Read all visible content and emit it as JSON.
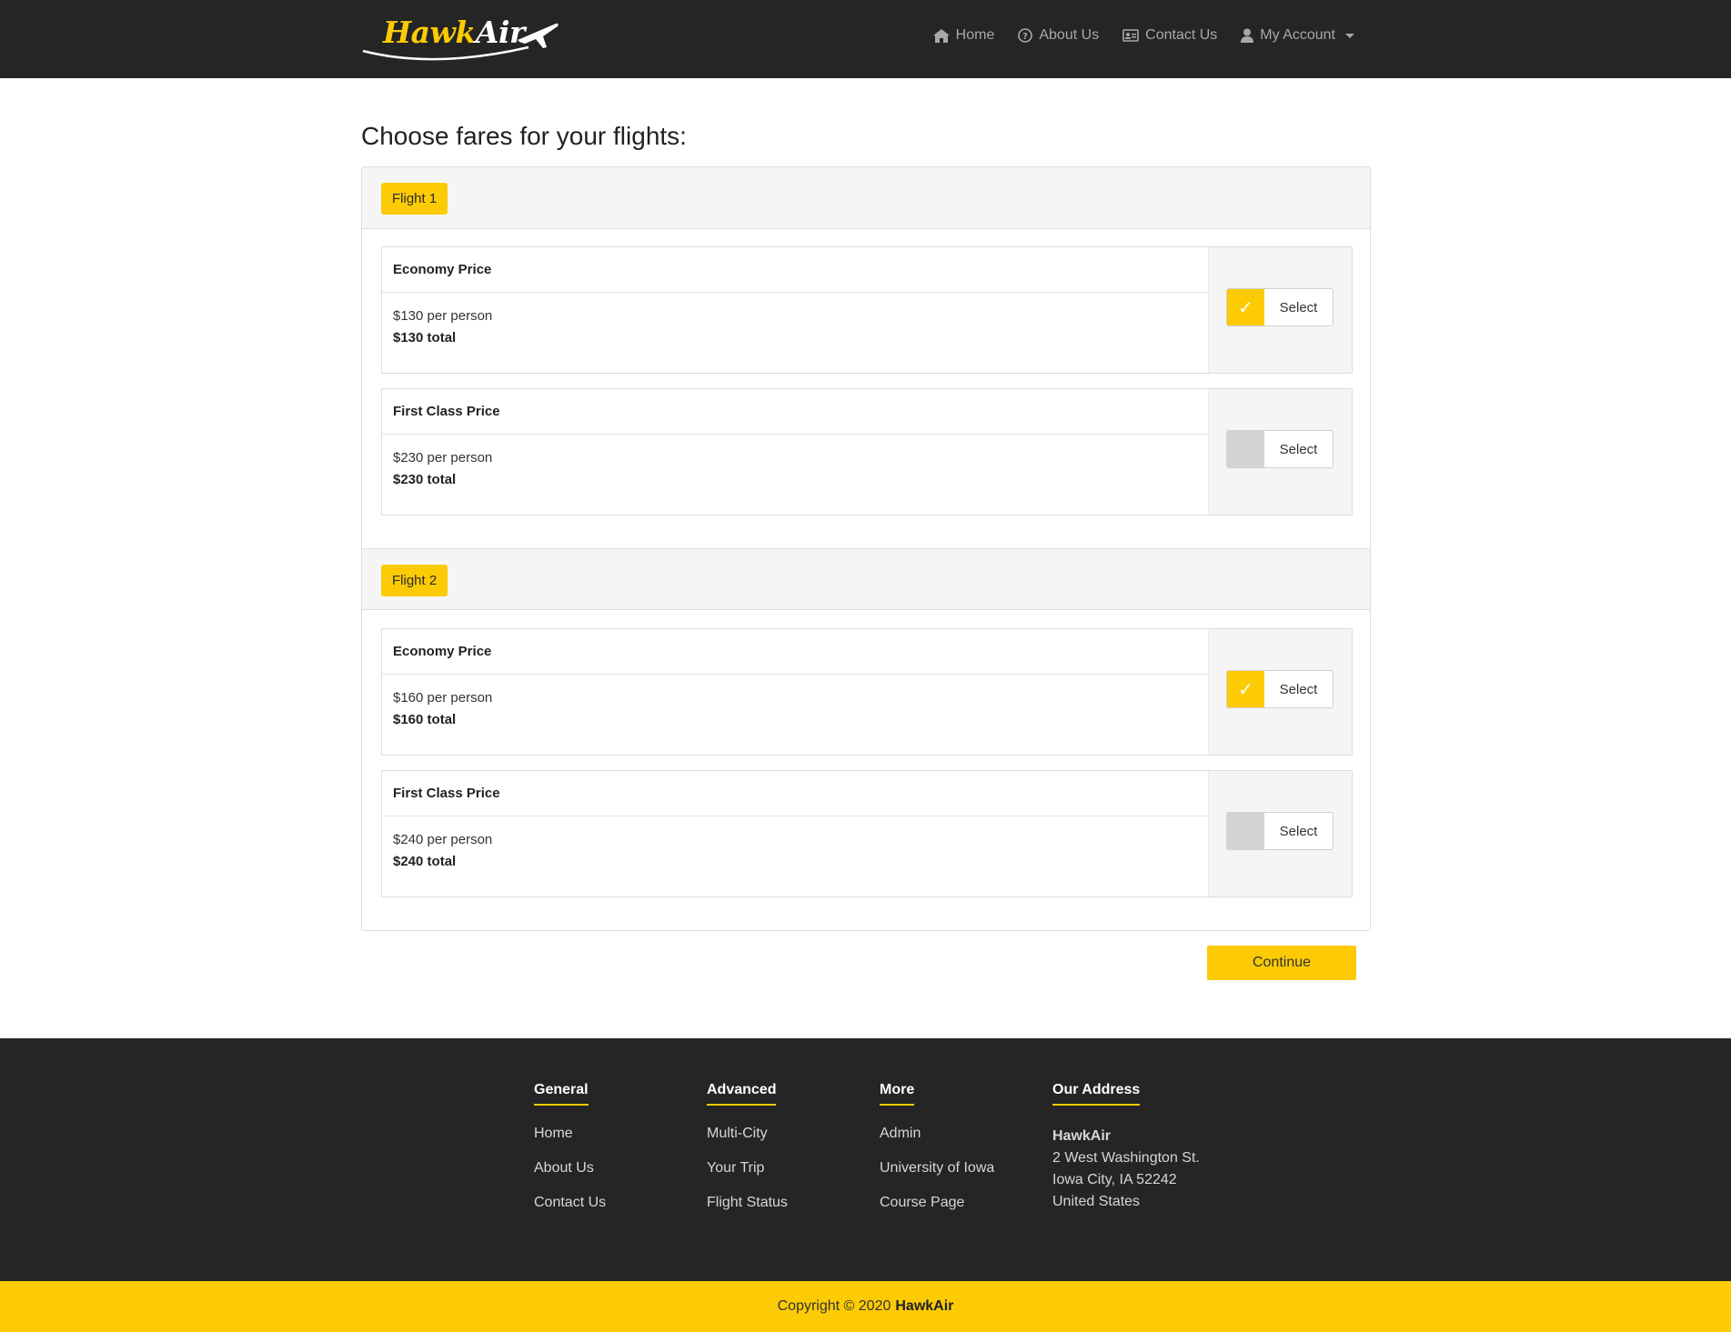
{
  "brand": {
    "hawk": "Hawk",
    "air": "Air",
    "icon": "airplane-icon"
  },
  "nav": {
    "home": {
      "label": "Home",
      "icon": "home-icon"
    },
    "about": {
      "label": "About Us",
      "icon": "question-circle-icon"
    },
    "contact": {
      "label": "Contact Us",
      "icon": "id-card-icon"
    },
    "account": {
      "label": "My Account",
      "icon": "user-icon"
    }
  },
  "page": {
    "title": "Choose fares for your flights:"
  },
  "flights": [
    {
      "badge": "Flight 1",
      "options": [
        {
          "title": "Economy Price",
          "per_person": "$130 per person",
          "total": "$130 total",
          "selected": true,
          "select_label": "Select",
          "check": "✓"
        },
        {
          "title": "First Class Price",
          "per_person": "$230 per person",
          "total": "$230 total",
          "selected": false,
          "select_label": "Select",
          "check": ""
        }
      ]
    },
    {
      "badge": "Flight 2",
      "options": [
        {
          "title": "Economy Price",
          "per_person": "$160 per person",
          "total": "$160 total",
          "selected": true,
          "select_label": "Select",
          "check": "✓"
        },
        {
          "title": "First Class Price",
          "per_person": "$240 per person",
          "total": "$240 total",
          "selected": false,
          "select_label": "Select",
          "check": ""
        }
      ]
    }
  ],
  "continue_label": "Continue",
  "footer": {
    "general": {
      "heading": "General",
      "links": [
        "Home",
        "About Us",
        "Contact Us"
      ]
    },
    "advanced": {
      "heading": "Advanced",
      "links": [
        "Multi-City",
        "Your Trip",
        "Flight Status"
      ]
    },
    "more": {
      "heading": "More",
      "links": [
        "Admin",
        "University of Iowa",
        "Course Page"
      ]
    },
    "address": {
      "heading": "Our Address",
      "name": "HawkAir",
      "lines": [
        "2 West Washington St.",
        "Iowa City, IA 52242",
        "United States"
      ]
    }
  },
  "copyright": {
    "text": "Copyright © 2020",
    "brand": "HawkAir"
  },
  "colors": {
    "accent": "#fccb05",
    "dark": "#252525",
    "unchecked": "#d2d3d5"
  }
}
